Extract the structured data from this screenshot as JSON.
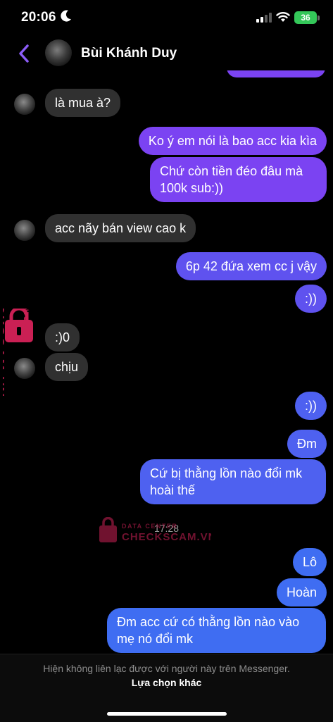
{
  "status_bar": {
    "time": "20:06",
    "battery": "36"
  },
  "header": {
    "contact_name": "Bùi Khánh Duy"
  },
  "messages": [
    {
      "direction": "incoming",
      "text": "là mua à?"
    },
    {
      "direction": "outgoing",
      "text": "Ko ý em nói là bao acc kia kìa"
    },
    {
      "direction": "outgoing",
      "text": "Chứ còn tiền đéo đâu mà 100k sub:))"
    },
    {
      "direction": "incoming",
      "text": "acc nãy bán view cao k"
    },
    {
      "direction": "outgoing",
      "text": "6p 42 đứa xem cc j vậy"
    },
    {
      "direction": "outgoing",
      "text": ":))"
    },
    {
      "direction": "incoming",
      "text": ":)0"
    },
    {
      "direction": "incoming",
      "text": "chịu"
    },
    {
      "direction": "outgoing",
      "text": ":))"
    },
    {
      "direction": "outgoing",
      "text": "Đm"
    },
    {
      "direction": "outgoing",
      "text": "Cứ bị thằng lồn nào đổi mk hoài thế"
    },
    {
      "direction": "outgoing",
      "text": "Lô"
    },
    {
      "direction": "outgoing",
      "text": "Hoàn"
    },
    {
      "direction": "outgoing",
      "text": "Đm acc cứ có thằng lồn nào vào mẹ nó đổi mk"
    }
  ],
  "timestamp": "17:28",
  "watermark": {
    "title": "CHECKSCAM.VN",
    "subtitle": "DATA CENTER"
  },
  "footer": {
    "note": "Hiện không liên lạc được với người này trên Messenger.",
    "action": "Lựa chọn khác"
  },
  "colors": {
    "bubble_incoming": "#303030",
    "bubble_outgoing_top": "#7b43f2",
    "bubble_outgoing_bottom": "#3f6df2",
    "back_arrow": "#8b5cf6",
    "watermark_red": "#e0245e"
  },
  "icons": [
    "moon-icon",
    "signal-icon",
    "wifi-icon",
    "battery-icon",
    "back-arrow-icon",
    "lock-icon"
  ]
}
